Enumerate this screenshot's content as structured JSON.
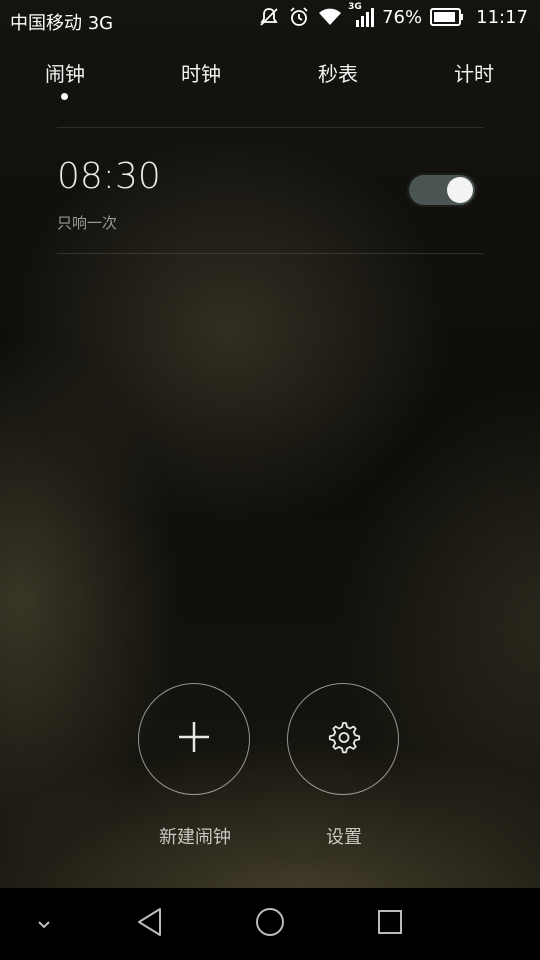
{
  "status_bar": {
    "carrier": "中国移动 3G",
    "network_badge": "3G",
    "battery_percent": "76%",
    "time": "11:17",
    "icons": [
      "no-vibrate-icon",
      "alarm-icon",
      "wifi-icon",
      "cellular-signal-icon",
      "battery-icon"
    ]
  },
  "tabs": [
    {
      "label": "闹钟",
      "active": true
    },
    {
      "label": "时钟",
      "active": false
    },
    {
      "label": "秒表",
      "active": false
    },
    {
      "label": "计时",
      "active": false
    }
  ],
  "alarms": [
    {
      "time": "08:30",
      "repeat": "只响一次",
      "enabled": true
    }
  ],
  "actions": {
    "new_alarm_label": "新建闹钟",
    "settings_label": "设置"
  },
  "navigation": {
    "icons": [
      "collapse-chevron-icon",
      "back-icon",
      "home-icon",
      "recents-icon"
    ]
  },
  "colors": {
    "toggle_track": "#4a5553",
    "toggle_knob": "#f3f3f3",
    "background": "#0d0c09"
  }
}
